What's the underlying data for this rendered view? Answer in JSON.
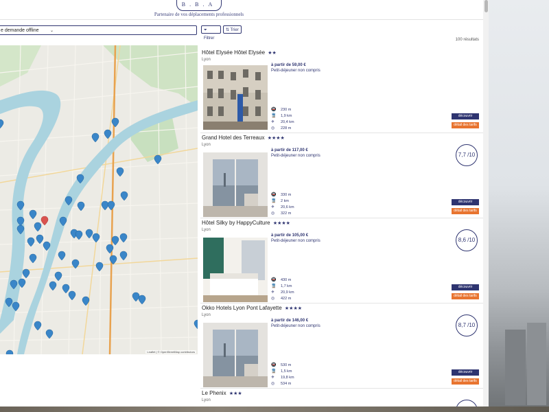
{
  "brand": {
    "logo_text": "B.B.A",
    "tagline": "Partenaire de vos déplacements professionnels"
  },
  "search": {
    "select_value": "e demande offline"
  },
  "toolbar": {
    "filter_label": "Filtrer",
    "sort_label": "Trier"
  },
  "results": {
    "count_label": "100 résultats"
  },
  "map": {
    "attribution": "Leaflet | © OpenStreetMap contributors"
  },
  "hotels": [
    {
      "name": "Hôtel Elysée Hôtel Elysée",
      "stars": "★★",
      "city": "Lyon",
      "price": "à partir de 59,00 €",
      "breakfast": "Petit-déjeuner non compris",
      "distances": [
        "230 m",
        "1,9 km",
        "20,4 km",
        "228 m"
      ],
      "rating": "",
      "discover": "découvrir",
      "rates": "détail des tarifs"
    },
    {
      "name": "Grand Hotel des Terreaux",
      "stars": "★★★★",
      "city": "Lyon",
      "price": "à partir de 117,00 €",
      "breakfast": "Petit-déjeuner non compris",
      "distances": [
        "330 m",
        "2 km",
        "20,6 km",
        "322 m"
      ],
      "rating": "7,7 /10",
      "discover": "découvrir",
      "rates": "détail des tarifs"
    },
    {
      "name": "Hôtel Silky by HappyCulture",
      "stars": "★★★★",
      "city": "Lyon",
      "price": "à partir de 105,00 €",
      "breakfast": "Petit-déjeuner non compris",
      "distances": [
        "430 m",
        "1,7 km",
        "20,9 km",
        "422 m"
      ],
      "rating": "8,6 /10",
      "discover": "découvrir",
      "rates": "détail des tarifs"
    },
    {
      "name": "Okko Hotels Lyon Pont Lafayette",
      "stars": "★★★★",
      "city": "Lyon",
      "price": "à partir de 146,00 €",
      "breakfast": "Petit-déjeuner non compris",
      "distances": [
        "530 m",
        "1,5 km",
        "19,8 km",
        "534 m"
      ],
      "rating": "8,7 /10",
      "discover": "découvrir",
      "rates": "détail des tarifs"
    },
    {
      "name": "Le Phenix",
      "stars": "★★★",
      "city": "Lyon"
    }
  ],
  "icons": {
    "distance_1": "metro-icon",
    "distance_2": "train-icon",
    "distance_3": "plane-icon",
    "distance_4": "target-icon"
  },
  "colors": {
    "brand": "#2e3470",
    "accent": "#e8742f"
  }
}
